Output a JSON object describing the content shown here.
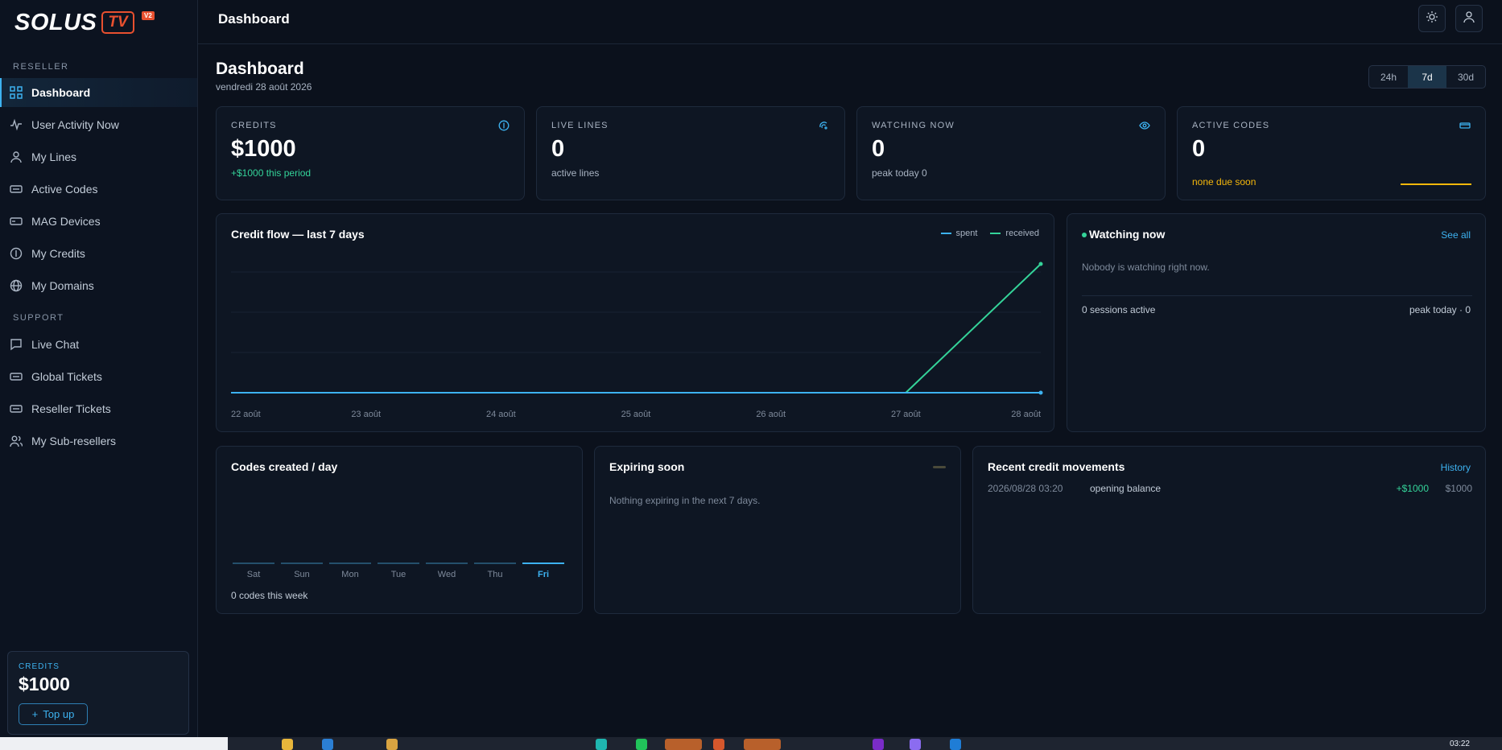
{
  "app": {
    "logo_main": "SOLUS",
    "logo_tv": "TV",
    "logo_badge": "V2",
    "header_title": "Dashboard"
  },
  "sidebar": {
    "section_reseller": "RESELLER",
    "section_support": "SUPPORT",
    "items": [
      {
        "label": "Dashboard",
        "icon": "grid-icon",
        "active": true
      },
      {
        "label": "User Activity Now",
        "icon": "activity-icon"
      },
      {
        "label": "My Lines",
        "icon": "user-icon"
      },
      {
        "label": "Active Codes",
        "icon": "ticket-icon"
      },
      {
        "label": "MAG Devices",
        "icon": "device-icon"
      },
      {
        "label": "My Credits",
        "icon": "coin-icon"
      },
      {
        "label": "My Domains",
        "icon": "globe-icon"
      },
      {
        "label": "Live Chat",
        "icon": "chat-icon"
      },
      {
        "label": "Global Tickets",
        "icon": "ticket-icon"
      },
      {
        "label": "Reseller Tickets",
        "icon": "ticket-icon"
      },
      {
        "label": "My Sub-resellers",
        "icon": "users-icon"
      }
    ],
    "credits_label": "CREDITS",
    "credits_value": "$1000",
    "topup_label": "Top up"
  },
  "page": {
    "title": "Dashboard",
    "date": "vendredi 28 août 2026",
    "ranges": [
      "24h",
      "7d",
      "30d"
    ],
    "active_range": "7d"
  },
  "stats": [
    {
      "label": "CREDITS",
      "value": "$1000",
      "sub": "+$1000 this period",
      "icon": "coin-icon"
    },
    {
      "label": "LIVE LINES",
      "value": "0",
      "sub": "active lines",
      "icon": "signal-icon"
    },
    {
      "label": "WATCHING NOW",
      "value": "0",
      "sub": "peak today 0",
      "icon": "eye-icon"
    },
    {
      "label": "ACTIVE CODES",
      "value": "0",
      "sub": "none due soon",
      "icon": "card-icon"
    }
  ],
  "credit_flow": {
    "title": "Credit flow — last 7 days",
    "legend_spent": "spent",
    "legend_received": "received"
  },
  "chart_data": [
    {
      "type": "line",
      "title": "Credit flow — last 7 days",
      "x": [
        "22 août",
        "23 août",
        "24 août",
        "25 août",
        "26 août",
        "27 août",
        "28 août"
      ],
      "series": [
        {
          "name": "spent",
          "values": [
            0,
            0,
            0,
            0,
            0,
            0,
            0
          ],
          "color": "#3db2f0"
        },
        {
          "name": "received",
          "values": [
            0,
            0,
            0,
            0,
            0,
            0,
            1000
          ],
          "color": "#34d399"
        }
      ],
      "ylim": [
        0,
        1000
      ],
      "grid": true,
      "legend": "top-right"
    },
    {
      "type": "bar",
      "title": "Codes created / day",
      "categories": [
        "Sat",
        "Sun",
        "Mon",
        "Tue",
        "Wed",
        "Thu",
        "Fri"
      ],
      "values": [
        0,
        0,
        0,
        0,
        0,
        0,
        0
      ],
      "highlight": "Fri"
    }
  ],
  "watching": {
    "title": "Watching now",
    "see_all": "See all",
    "empty": "Nobody is watching right now.",
    "sessions": "0 sessions active",
    "peak": "peak today · 0"
  },
  "codes": {
    "title": "Codes created / day",
    "summary": "0 codes this week"
  },
  "expiring": {
    "title": "Expiring soon",
    "empty": "Nothing expiring in the next 7 days."
  },
  "movements": {
    "title": "Recent credit movements",
    "history": "History",
    "rows": [
      {
        "date": "2026/08/28 03:20",
        "desc": "opening balance",
        "amount": "+$1000",
        "balance": "$1000"
      }
    ]
  },
  "taskbar": {
    "clock": "03:22"
  }
}
